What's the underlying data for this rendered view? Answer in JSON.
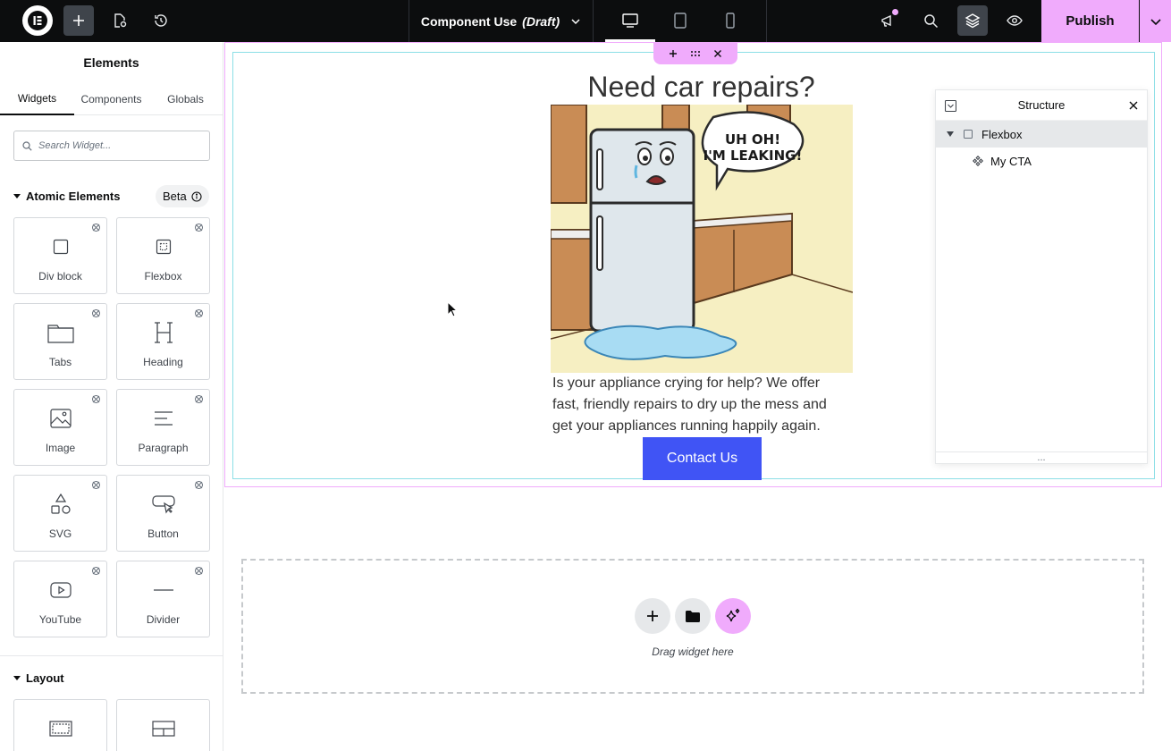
{
  "topbar": {
    "document_title": "Component Use",
    "document_status": "(Draft)",
    "publish_label": "Publish"
  },
  "sidebar": {
    "title": "Elements",
    "tabs": [
      "Widgets",
      "Components",
      "Globals"
    ],
    "search_placeholder": "Search Widget...",
    "atomic_section": "Atomic Elements",
    "beta_label": "Beta",
    "widgets": [
      "Div block",
      "Flexbox",
      "Tabs",
      "Heading",
      "Image",
      "Paragraph",
      "SVG",
      "Button",
      "YouTube",
      "Divider"
    ],
    "layout_section": "Layout"
  },
  "canvas": {
    "headline": "Need car repairs?",
    "image_speech": [
      "UH OH!",
      "I'M LEAKING!"
    ],
    "body_text": "Is your appliance crying for help? We offer fast, friendly repairs to dry up the mess and get your appliances running happily again.",
    "cta_label": "Contact Us",
    "drop_zone_text": "Drag widget here"
  },
  "structure": {
    "title": "Structure",
    "items": [
      "Flexbox",
      "My CTA"
    ]
  },
  "colors": {
    "topbar_bg": "#0c0d0e",
    "accent_pink": "#f0abfc",
    "cta_blue": "#4054f5",
    "frame_cyan": "#8cdfe6"
  }
}
